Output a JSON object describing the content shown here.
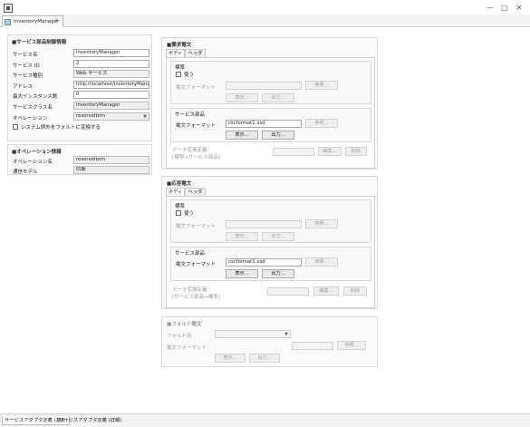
{
  "window": {
    "minimize": "—",
    "maximize": "□",
    "close": "✕"
  },
  "editor_tab": {
    "label": "InventoryManager",
    "close": "✕"
  },
  "service_settings": {
    "header": "■サービス部品制御情報",
    "fields": [
      {
        "label": "サービス名",
        "value": "InventoryManager"
      },
      {
        "label": "サービス ID",
        "value": "2"
      },
      {
        "label": "サービス種別",
        "value": "Web サービス"
      },
      {
        "label": "アドレス",
        "value": "http://localhost/InventoryMana"
      },
      {
        "label": "最大インスタンス数",
        "value": "0"
      },
      {
        "label": "サービスクラス名",
        "value": "InventoryManager"
      }
    ],
    "operation_label": "オペレーション",
    "operation_value": "reserveItem",
    "convert_fault_label": "システム例外をフォルトに変換する"
  },
  "operation_info": {
    "header": "■オペレーション情報",
    "fields": [
      {
        "label": "オペレーション名",
        "value": "reserveItem"
      },
      {
        "label": "通信モデル",
        "value": "同期"
      }
    ]
  },
  "request": {
    "header": "■要求電文",
    "tabs": [
      "ボディ",
      "ヘッダ"
    ],
    "standard": {
      "header": "標準",
      "use_label": "使う",
      "format_label": "電文フォーマット",
      "browse": "参照...",
      "display": "表示...",
      "output": "出力..."
    },
    "service": {
      "header": "サービス部品",
      "format_label": "電文フォーマット",
      "format_value": "cscformat1.xsd",
      "browse": "参照...",
      "display": "表示...",
      "output": "出力..."
    },
    "conversion": {
      "line1": "データ変換定義",
      "line2": "[標準→サービス部品]",
      "edit": "編集...",
      "delete": "削除"
    }
  },
  "response": {
    "header": "■応答電文",
    "tabs": [
      "ボディ",
      "ヘッダ"
    ],
    "standard": {
      "header": "標準",
      "use_label": "使う",
      "format_label": "電文フォーマット",
      "browse": "参照...",
      "display": "表示...",
      "output": "出力..."
    },
    "service": {
      "header": "サービス部品",
      "format_label": "電文フォーマット",
      "format_value": "cscformat1.xsd",
      "browse": "参照...",
      "display": "表示...",
      "output": "出力..."
    },
    "conversion": {
      "line1": "データ変換定義",
      "line2": "[サービス部品→標準]",
      "edit": "編集...",
      "delete": "削除"
    }
  },
  "fault": {
    "header": "■フォルト電文",
    "fault_name_label": "フォルト名",
    "format_label": "電文フォーマット",
    "browse": "参照...",
    "display": "表示...",
    "output": "出力..."
  },
  "bottom_tabs": [
    "サービスアダプタ定義 (基本)",
    "サービスアダプタ定義 (詳細)"
  ]
}
